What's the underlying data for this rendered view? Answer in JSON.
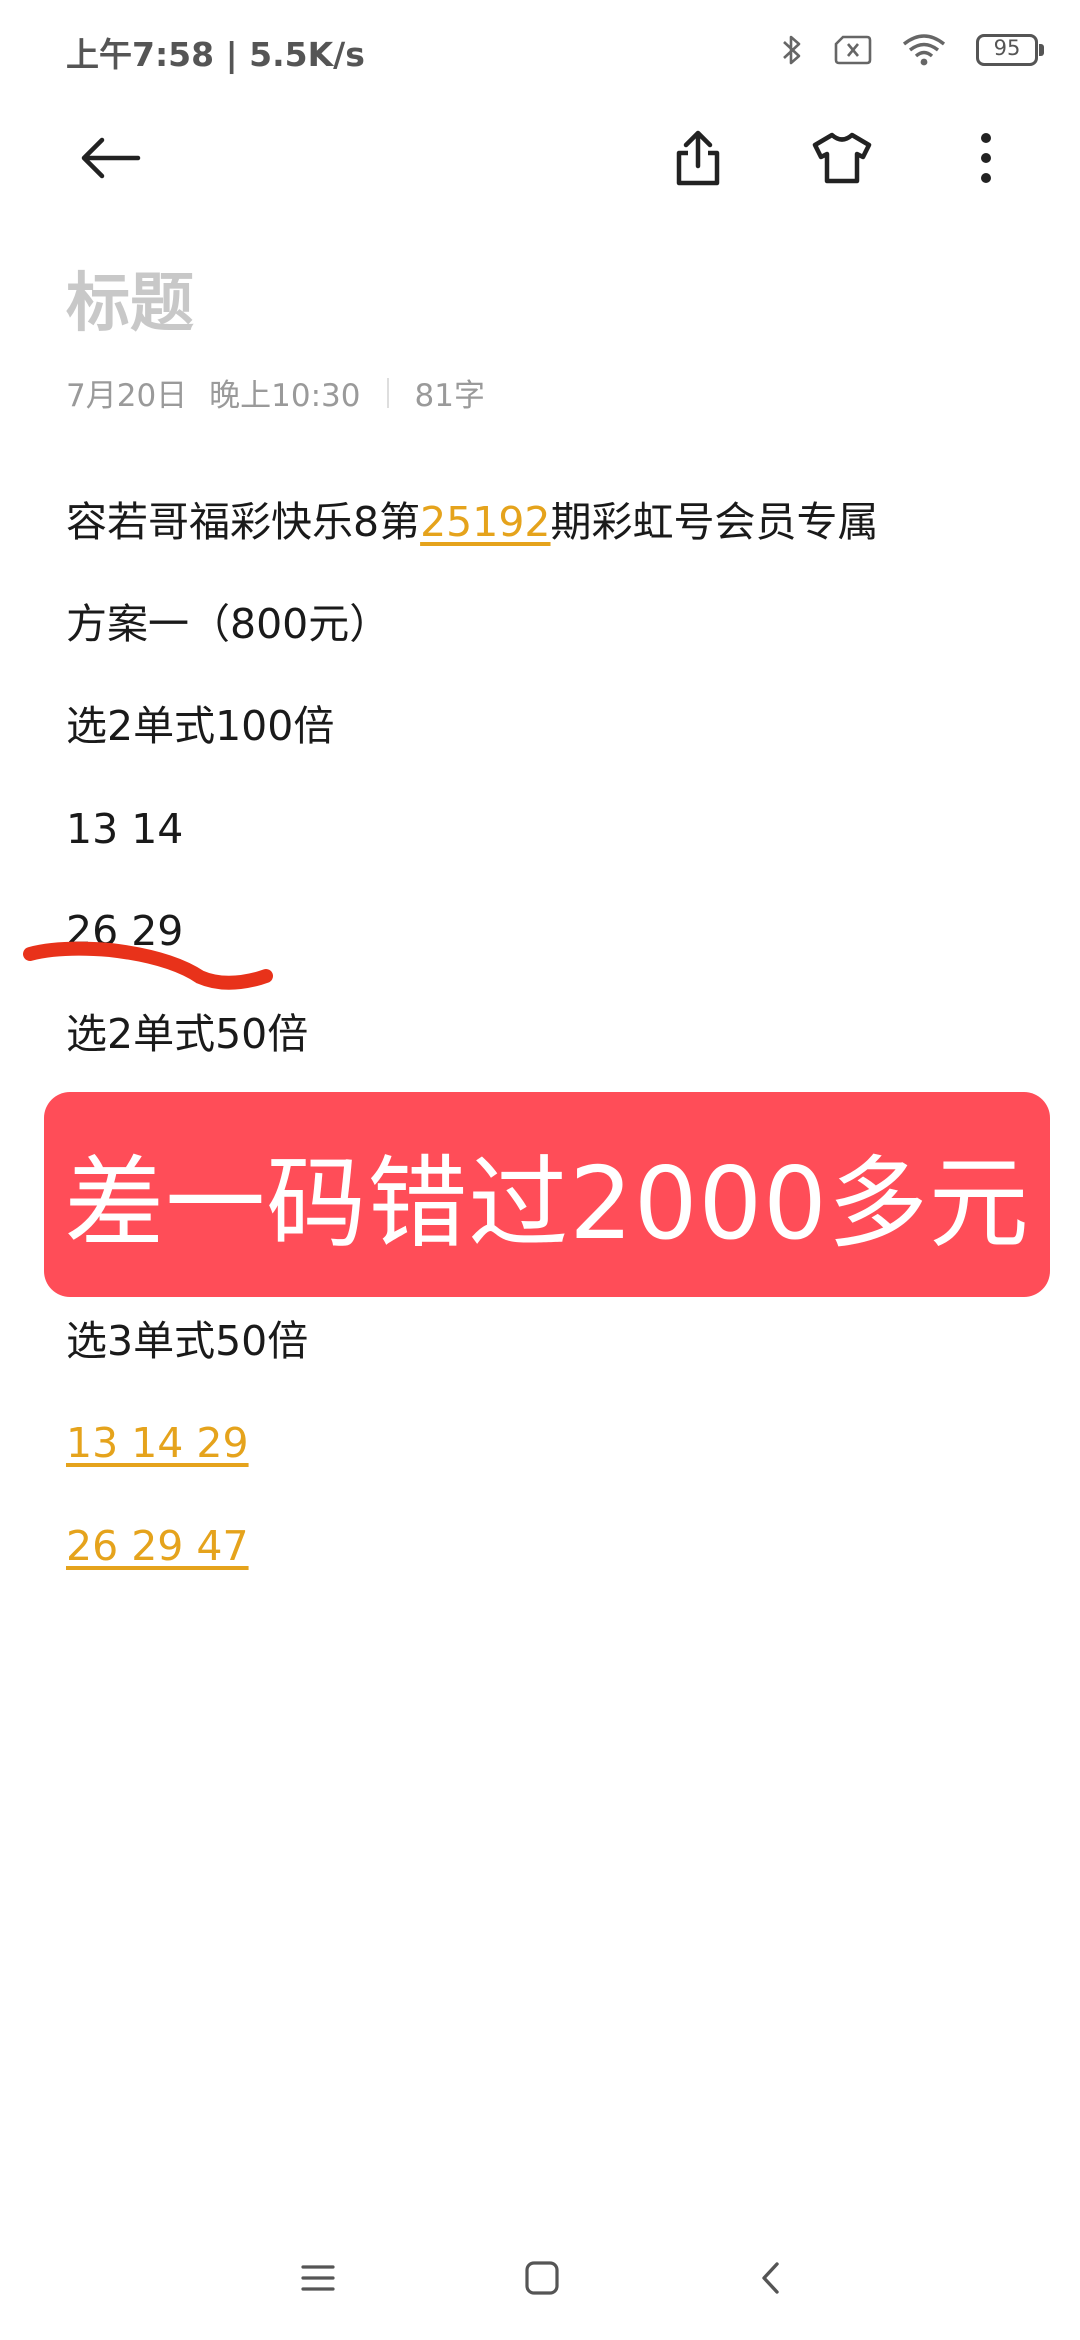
{
  "status_bar": {
    "time": "上午7:58 | 5.5K/s",
    "battery_level": "95",
    "icons": [
      "bluetooth-icon",
      "sim-off-icon",
      "wifi-icon",
      "battery-icon"
    ]
  },
  "toolbar": {
    "icons": [
      "back-arrow-icon",
      "share-icon",
      "theme-shirt-icon",
      "more-vertical-icon"
    ]
  },
  "note": {
    "title_placeholder": "标题",
    "date": "7月20日",
    "time": "晚上10:30",
    "word_count": "81字",
    "lines": {
      "headline_prefix": "容若哥福彩快乐8第",
      "headline_issue": "25192",
      "headline_suffix": "期彩虹号会员专属",
      "plan": "方案一（800元）",
      "pick2_100": "选2单式100倍",
      "pick2_100_row1": "13 14",
      "pick2_100_row2": "26 29",
      "pick2_50": "选2单式50倍",
      "pick3_50": "选3单式50倍",
      "pick3_50_row1": "13 14 29",
      "pick3_50_row2": "26 29 47"
    }
  },
  "overlay_banner": {
    "text": "差一码错过2000多元",
    "color": "#ff4d58"
  },
  "nav_bar": {
    "icons": [
      "menu-icon",
      "home-square-icon",
      "back-chevron-icon"
    ]
  },
  "colors": {
    "link": "#e5a31c",
    "annotation_stroke": "#e8321a"
  }
}
